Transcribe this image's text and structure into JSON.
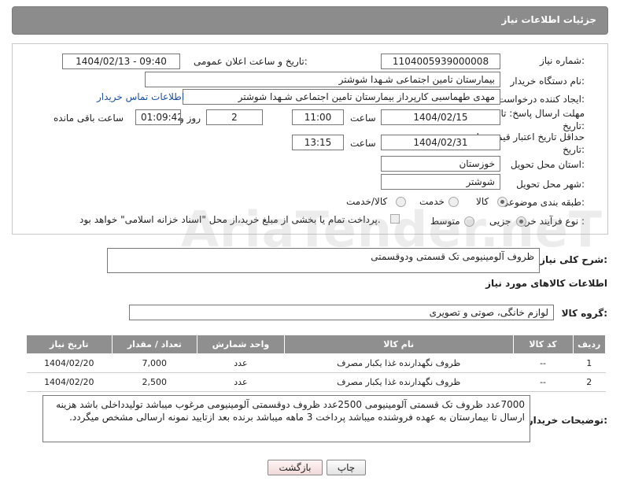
{
  "header": {
    "title": "جزئیات اطلاعات نیاز"
  },
  "form": {
    "need_number_label": "شماره نیاز:",
    "need_number": "1104005939000008",
    "announce_label": "تاریخ و ساعت اعلان عمومی:",
    "announce_value": "1404/02/13 - 09:40",
    "buyer_org_label": "نام دستگاه خریدار:",
    "buyer_org": "بیمارستان تامین اجتماعی شـهدا شوشتر",
    "requester_label": "ایجاد کننده درخواست:",
    "requester": "مهدی طهماسبی کارپرداز بیمارستان تامین اجتماعی شـهدا شوشتر",
    "contact_link": "اطلاعات تماس خریدار",
    "deadline_label": "مهلت ارسال پاسخ: تا تاریخ:",
    "deadline_date": "1404/02/15",
    "time_label": "ساعت",
    "deadline_time": "11:00",
    "days_value": "2",
    "days_label": "روز و",
    "remaining_time": "01:09:42",
    "remaining_label": "ساعت باقی مانده",
    "validity_label": "حداقل تاریخ اعتبار قیمت: تا تاریخ:",
    "validity_date": "1404/02/31",
    "validity_time": "13:15",
    "province_label": "استان محل تحویل:",
    "province": "خوزستان",
    "city_label": "شهر محل تحویل:",
    "city": "شوشتر",
    "category_label": "طبقه بندی موضوعی:",
    "category_options": [
      "کالا",
      "خدمت",
      "کالا/خدمت"
    ],
    "category_selected": "کالا",
    "process_label": "نوع فرآیند خرید :",
    "process_options": [
      "جزیی",
      "متوسط"
    ],
    "process_selected": "جزیی",
    "payment_note": "پرداخت تمام یا بخشی از مبلغ خرید،از محل \"اسناد خزانه اسلامی\" خواهد بود."
  },
  "description": {
    "label": "شرح کلی نیاز:",
    "value": "ظروف آلومینیومی تک قسمتی ودوقسمتی"
  },
  "goods": {
    "section_title": "اطلاعات کالاهای مورد نیاز",
    "group_label": "گروه کالا:",
    "group_value": "لوازم خانگی، صوتی و تصویری",
    "columns": [
      "ردیف",
      "کد کالا",
      "نام کالا",
      "واحد شمارش",
      "تعداد / مقدار",
      "تاریخ نیاز"
    ],
    "rows": [
      {
        "index": "1",
        "code": "--",
        "name": "ظروف نگهدارنده غذا یکبار مصرف",
        "unit": "عدد",
        "qty": "7,000",
        "date": "1404/02/20"
      },
      {
        "index": "2",
        "code": "--",
        "name": "ظروف نگهدارنده غذا یکبار مصرف",
        "unit": "عدد",
        "qty": "2,500",
        "date": "1404/02/20"
      }
    ]
  },
  "buyer_notes": {
    "label": "توضیحات خریدار:",
    "value": "7000عدد ظروف تک قسمتی آلومینیومی 2500عدد ظروف دوقسمتی آلومینیومی مرغوب میباشد تولیدداخلی باشد هزینه ارسال تا بیمارستان به عهده فروشنده میباشد پرداخت 3 ماهه میباشد برنده بعد ازتایید  نمونه ارسالی  مشخص میگردد."
  },
  "buttons": {
    "print": "چاپ",
    "back": "بازگشت"
  },
  "watermark": {
    "text": "AriaTender.neT"
  }
}
